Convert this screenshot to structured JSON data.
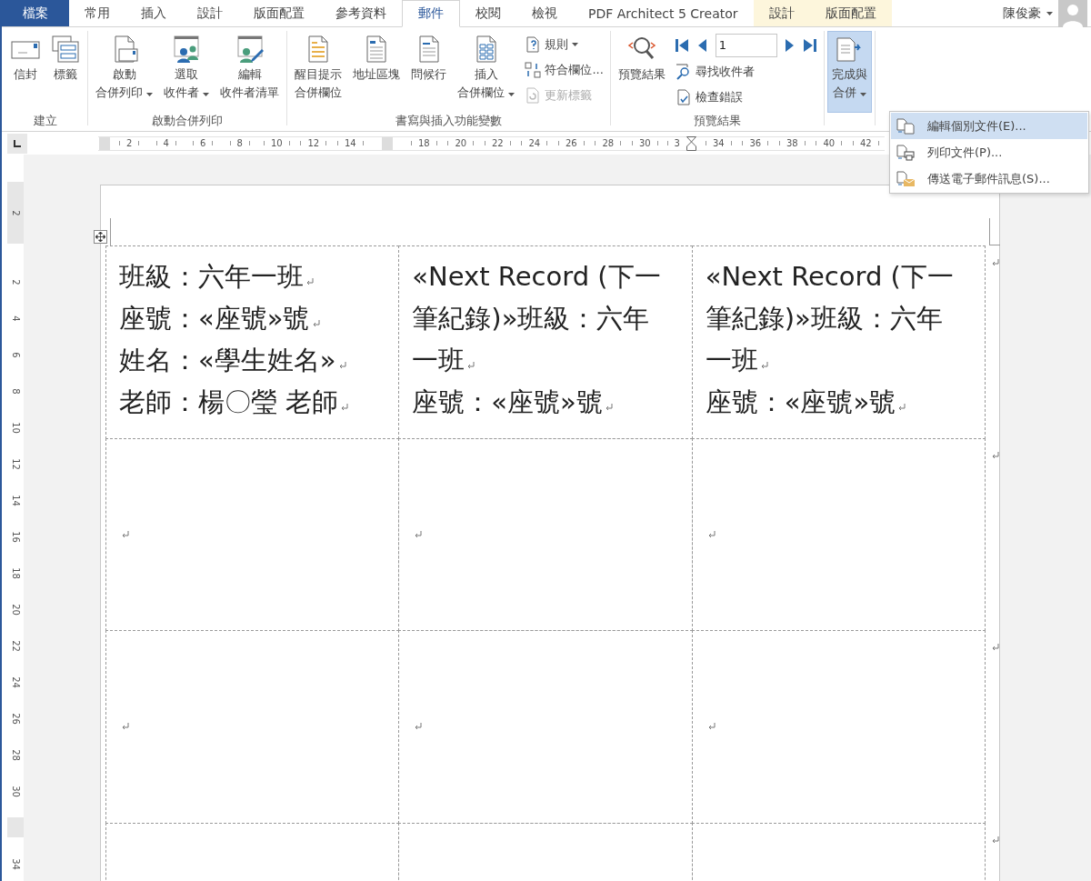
{
  "tabs": [
    {
      "label": "檔案",
      "kind": "file",
      "selected": false
    },
    {
      "label": "常用",
      "kind": "normal",
      "selected": false
    },
    {
      "label": "插入",
      "kind": "normal",
      "selected": false
    },
    {
      "label": "設計",
      "kind": "normal",
      "selected": false
    },
    {
      "label": "版面配置",
      "kind": "normal",
      "selected": false
    },
    {
      "label": "參考資料",
      "kind": "normal",
      "selected": false
    },
    {
      "label": "郵件",
      "kind": "normal",
      "selected": true
    },
    {
      "label": "校閱",
      "kind": "normal",
      "selected": false
    },
    {
      "label": "檢視",
      "kind": "normal",
      "selected": false
    },
    {
      "label": "PDF Architect 5 Creator",
      "kind": "normal",
      "selected": false
    },
    {
      "label": "設計",
      "kind": "contextual",
      "selected": false
    },
    {
      "label": "版面配置",
      "kind": "contextual",
      "selected": false
    }
  ],
  "user": {
    "name": "陳俊豪"
  },
  "ribbon_groups": [
    {
      "label": "建立",
      "items": [
        {
          "kind": "large",
          "lines": [
            "信封"
          ],
          "dropdown": false,
          "pressed": false
        },
        {
          "kind": "large",
          "lines": [
            "標籤"
          ],
          "dropdown": false,
          "pressed": false
        }
      ]
    },
    {
      "label": "啟動合併列印",
      "items": [
        {
          "kind": "large",
          "lines": [
            "啟動",
            "合併列印"
          ],
          "dropdown": true,
          "pressed": false
        },
        {
          "kind": "large",
          "lines": [
            "選取",
            "收件者"
          ],
          "dropdown": true,
          "pressed": false
        },
        {
          "kind": "large",
          "lines": [
            "編輯",
            "收件者清單"
          ],
          "dropdown": false,
          "pressed": false
        }
      ]
    },
    {
      "label": "書寫與插入功能變數",
      "items": [
        {
          "kind": "large",
          "lines": [
            "醒目提示",
            "合併欄位"
          ],
          "dropdown": false,
          "pressed": false
        },
        {
          "kind": "large",
          "lines": [
            "地址區塊"
          ],
          "dropdown": false,
          "pressed": false
        },
        {
          "kind": "large",
          "lines": [
            "問候行"
          ],
          "dropdown": false,
          "pressed": false
        },
        {
          "kind": "large",
          "lines": [
            "插入",
            "合併欄位"
          ],
          "dropdown": true,
          "pressed": false
        },
        {
          "kind": "stack",
          "rows": [
            {
              "kind": "small",
              "label": "規則",
              "dropdown": true,
              "disabled": false
            },
            {
              "kind": "small",
              "label": "符合欄位...",
              "dropdown": false,
              "disabled": false
            },
            {
              "kind": "small",
              "label": "更新標籤",
              "dropdown": false,
              "disabled": true
            }
          ]
        }
      ]
    },
    {
      "label": "預覽結果",
      "items": [
        {
          "kind": "large",
          "lines": [
            "預覽結果"
          ],
          "dropdown": false,
          "pressed": false
        },
        {
          "kind": "stack",
          "rows": [
            {
              "kind": "nav",
              "value": "1"
            },
            {
              "kind": "small",
              "label": "尋找收件者",
              "dropdown": false,
              "disabled": false
            },
            {
              "kind": "small",
              "label": "檢查錯誤",
              "dropdown": false,
              "disabled": false
            }
          ]
        }
      ]
    },
    {
      "items": [
        {
          "kind": "large",
          "lines": [
            "完成與",
            "合併"
          ],
          "dropdown": true,
          "pressed": true
        }
      ]
    }
  ],
  "horizontal_ruler": [
    {
      "kind": "margin"
    },
    {
      "kind": "number",
      "text": "2"
    },
    {
      "kind": "number",
      "text": "4"
    },
    {
      "kind": "number",
      "text": "6"
    },
    {
      "kind": "number",
      "text": "8"
    },
    {
      "kind": "number",
      "text": "10"
    },
    {
      "kind": "number",
      "text": "12"
    },
    {
      "kind": "number",
      "text": "14"
    },
    {
      "kind": "margin"
    },
    {
      "kind": "number",
      "text": "18"
    },
    {
      "kind": "number",
      "text": "20"
    },
    {
      "kind": "number",
      "text": "22"
    },
    {
      "kind": "number",
      "text": "24"
    },
    {
      "kind": "number",
      "text": "26"
    },
    {
      "kind": "number",
      "text": "28"
    },
    {
      "kind": "number",
      "text": "30"
    },
    {
      "kind": "indent",
      "text": "3"
    },
    {
      "kind": "number",
      "text": "34"
    },
    {
      "kind": "number",
      "text": "36"
    },
    {
      "kind": "number",
      "text": "38"
    },
    {
      "kind": "number",
      "text": "40"
    },
    {
      "kind": "number",
      "text": "42"
    }
  ],
  "vertical_ruler": [
    {
      "kind": "top",
      "text": "2"
    },
    {
      "kind": "number",
      "text": "2"
    },
    {
      "kind": "number",
      "text": "4"
    },
    {
      "kind": "number",
      "text": "6"
    },
    {
      "kind": "number",
      "text": "8"
    },
    {
      "kind": "number",
      "text": "10"
    },
    {
      "kind": "number",
      "text": "12"
    },
    {
      "kind": "number",
      "text": "14"
    },
    {
      "kind": "number",
      "text": "16"
    },
    {
      "kind": "number",
      "text": "18"
    },
    {
      "kind": "number",
      "text": "20"
    },
    {
      "kind": "number",
      "text": "22"
    },
    {
      "kind": "number",
      "text": "24"
    },
    {
      "kind": "number",
      "text": "26"
    },
    {
      "kind": "number",
      "text": "28"
    },
    {
      "kind": "number",
      "text": "30"
    },
    {
      "kind": "margin"
    },
    {
      "kind": "number",
      "text": "34"
    }
  ],
  "label_table": {
    "rows": [
      {
        "cells": [
          {
            "kind": "text",
            "paragraphs": [
              "班級：六年一班",
              "座號：«座號»號",
              "姓名：«學生姓名»",
              "老師：楊〇瑩  老師"
            ]
          },
          {
            "kind": "text",
            "paragraphs": [
              "«Next Record (下一筆紀錄)»班級：六年一班",
              "座號：«座號»號"
            ]
          },
          {
            "kind": "text",
            "paragraphs": [
              "«Next Record (下一筆紀錄)»班級：六年一班",
              "座號：«座號»號"
            ]
          }
        ]
      },
      {
        "cells": [
          {
            "kind": "empty"
          },
          {
            "kind": "empty"
          },
          {
            "kind": "empty"
          }
        ]
      },
      {
        "cells": [
          {
            "kind": "empty"
          },
          {
            "kind": "empty"
          },
          {
            "kind": "empty"
          }
        ]
      },
      {
        "cells": [
          {
            "kind": "blank"
          },
          {
            "kind": "blank"
          },
          {
            "kind": "blank"
          }
        ]
      }
    ]
  },
  "menu": {
    "items": [
      {
        "label": "編輯個別文件(E)...",
        "selected": true
      },
      {
        "label": "列印文件(P)...",
        "selected": false
      },
      {
        "label": "傳送電子郵件訊息(S)...",
        "selected": false
      }
    ]
  }
}
